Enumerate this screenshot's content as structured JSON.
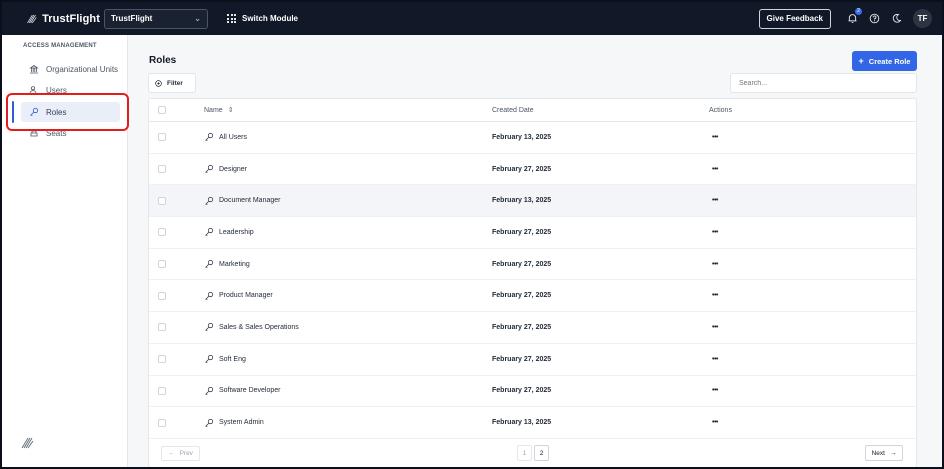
{
  "topbar": {
    "brand": "TrustFlight",
    "org_selected": "TrustFlight",
    "switch_module": "Switch Module",
    "feedback": "Give Feedback",
    "notification_count": "2",
    "avatar_initials": "TF"
  },
  "sidebar": {
    "section": "ACCESS MANAGEMENT",
    "items": [
      {
        "label": "Organizational Units",
        "icon": "building-icon"
      },
      {
        "label": "Users",
        "icon": "users-icon"
      },
      {
        "label": "Roles",
        "icon": "key-icon",
        "active": true
      },
      {
        "label": "Seats",
        "icon": "seats-icon"
      }
    ]
  },
  "main": {
    "title": "Roles",
    "create_button": "Create Role",
    "filter_label": "Filter",
    "search_placeholder": "Search...",
    "columns": {
      "name": "Name",
      "created": "Created Date",
      "actions": "Actions"
    },
    "rows": [
      {
        "name": "All Users",
        "date": "February 13, 2025"
      },
      {
        "name": "Designer",
        "date": "February 27, 2025"
      },
      {
        "name": "Document Manager",
        "date": "February 13, 2025"
      },
      {
        "name": "Leadership",
        "date": "February 27, 2025"
      },
      {
        "name": "Marketing",
        "date": "February 27, 2025"
      },
      {
        "name": "Product Manager",
        "date": "February 27, 2025"
      },
      {
        "name": "Sales & Sales Operations",
        "date": "February 27, 2025"
      },
      {
        "name": "Soft Eng",
        "date": "February 27, 2025"
      },
      {
        "name": "Software Developer",
        "date": "February 27, 2025"
      },
      {
        "name": "System Admin",
        "date": "February 13, 2025"
      }
    ],
    "actions_glyph": "•••",
    "pagination": {
      "prev": "Prev",
      "next": "Next",
      "pages": [
        "1",
        "2"
      ],
      "current": "2"
    }
  },
  "colors": {
    "accent": "#3366e6",
    "topbar": "#111827",
    "highlight": "#e11d1d"
  }
}
